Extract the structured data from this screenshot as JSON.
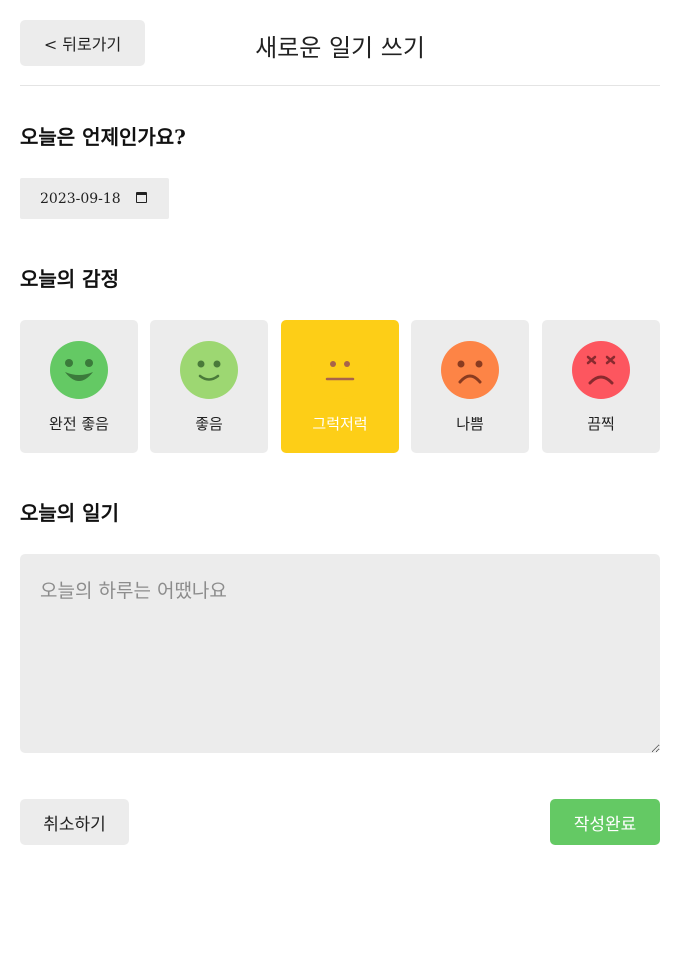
{
  "header": {
    "back_label": "< 뒤로가기",
    "title": "새로운 일기 쓰기"
  },
  "date_section": {
    "title": "오늘은 언제인가요?",
    "value": "2023-09-18",
    "icon": "calendar-icon"
  },
  "emotion_section": {
    "title": "오늘의 감정",
    "selected": 3,
    "items": [
      {
        "label": "완전 좋음",
        "icon": "very-happy-face-icon",
        "color": "#64c964"
      },
      {
        "label": "좋음",
        "icon": "happy-face-icon",
        "color": "#9dd772"
      },
      {
        "label": "그럭저럭",
        "icon": "neutral-face-icon",
        "color": "#fdce17"
      },
      {
        "label": "나쁨",
        "icon": "sad-face-icon",
        "color": "#fd8446"
      },
      {
        "label": "끔찍",
        "icon": "terrible-face-icon",
        "color": "#fd565f"
      }
    ]
  },
  "diary_section": {
    "title": "오늘의 일기",
    "placeholder": "오늘의 하루는 어땠나요",
    "value": ""
  },
  "actions": {
    "cancel_label": "취소하기",
    "submit_label": "작성완료"
  },
  "colors": {
    "accent_green": "#64c964",
    "selected_yellow": "#fdce17",
    "panel_gray": "#ececec"
  }
}
